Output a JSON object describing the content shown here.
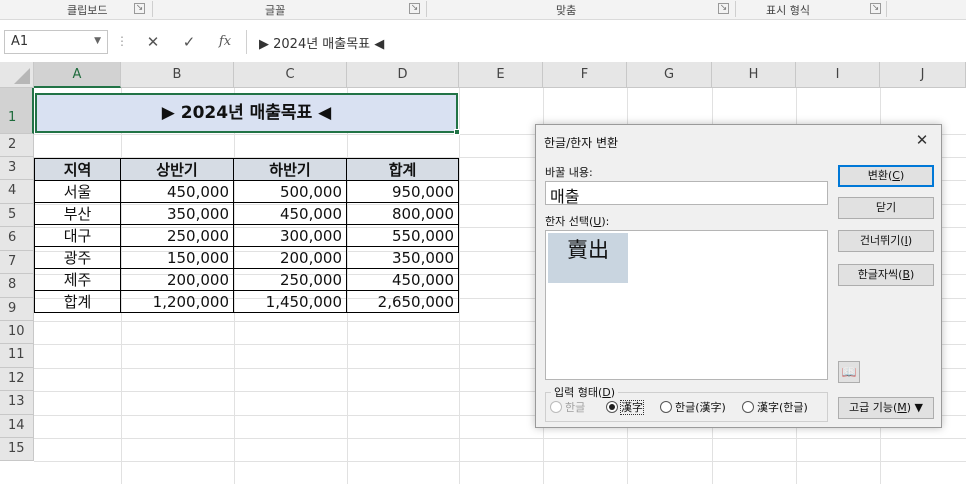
{
  "ribbon": {
    "groups": [
      {
        "label": "클립보드"
      },
      {
        "label": "글꼴"
      },
      {
        "label": "맞춤"
      },
      {
        "label": "표시 형식"
      }
    ]
  },
  "formula_bar": {
    "name_box": "A1",
    "cancel_icon": "✕",
    "enter_icon": "✓",
    "fx_icon": "fx",
    "content": "▶ 2024년 매출목표 ◀"
  },
  "grid": {
    "columns": [
      "A",
      "B",
      "C",
      "D",
      "E",
      "F",
      "G",
      "H",
      "I",
      "J"
    ],
    "rows": [
      "1",
      "2",
      "3",
      "4",
      "5",
      "6",
      "7",
      "8",
      "9",
      "10",
      "11",
      "12",
      "13",
      "14",
      "15"
    ],
    "selected_column": "A",
    "selected_row": "1"
  },
  "sheet": {
    "title": "▶ 2024년 매출목표 ◀",
    "headers": [
      "지역",
      "상반기",
      "하반기",
      "합계"
    ],
    "rows": [
      [
        "서울",
        "450,000",
        "500,000",
        "950,000"
      ],
      [
        "부산",
        "350,000",
        "450,000",
        "800,000"
      ],
      [
        "대구",
        "250,000",
        "300,000",
        "550,000"
      ],
      [
        "광주",
        "150,000",
        "200,000",
        "350,000"
      ],
      [
        "제주",
        "200,000",
        "250,000",
        "450,000"
      ],
      [
        "합계",
        "1,200,000",
        "1,450,000",
        "2,650,000"
      ]
    ]
  },
  "dialog": {
    "title": "한글/한자 변환",
    "close_icon": "✕",
    "source_label": "바꿀 내용:",
    "source_value": "매출",
    "hanja_label_prefix": "한자 선택(",
    "hanja_label_key": "U",
    "hanja_label_suffix": "):",
    "hanja_options": [
      "賣出"
    ],
    "input_form_label_prefix": "입력 형태(",
    "input_form_label_key": "D",
    "input_form_label_suffix": ")",
    "radio_options": [
      {
        "label": "한글",
        "checked": false,
        "disabled": true
      },
      {
        "label": "漢字",
        "checked": true,
        "disabled": false
      },
      {
        "label": "한글(漢字)",
        "checked": false,
        "disabled": false
      },
      {
        "label": "漢字(한글)",
        "checked": false,
        "disabled": false
      }
    ],
    "buttons": {
      "convert": {
        "prefix": "변환(",
        "key": "C",
        "suffix": ")"
      },
      "close": {
        "label": "닫기"
      },
      "skip": {
        "prefix": "건너뛰기(",
        "key": "I",
        "suffix": ")"
      },
      "dictionary": {
        "prefix": "한글자씩(",
        "key": "B",
        "suffix": ")"
      },
      "advanced": {
        "prefix": "고급 기능(",
        "key": "M",
        "suffix": ") ▼"
      }
    },
    "book_icon": "📖"
  },
  "colors": {
    "title_fill": "#d9e1f2",
    "header_fill": "#d6dce4",
    "selection": "#217346",
    "hanja_highlight": "#c9d5e0",
    "default_button_border": "#0078d7"
  }
}
